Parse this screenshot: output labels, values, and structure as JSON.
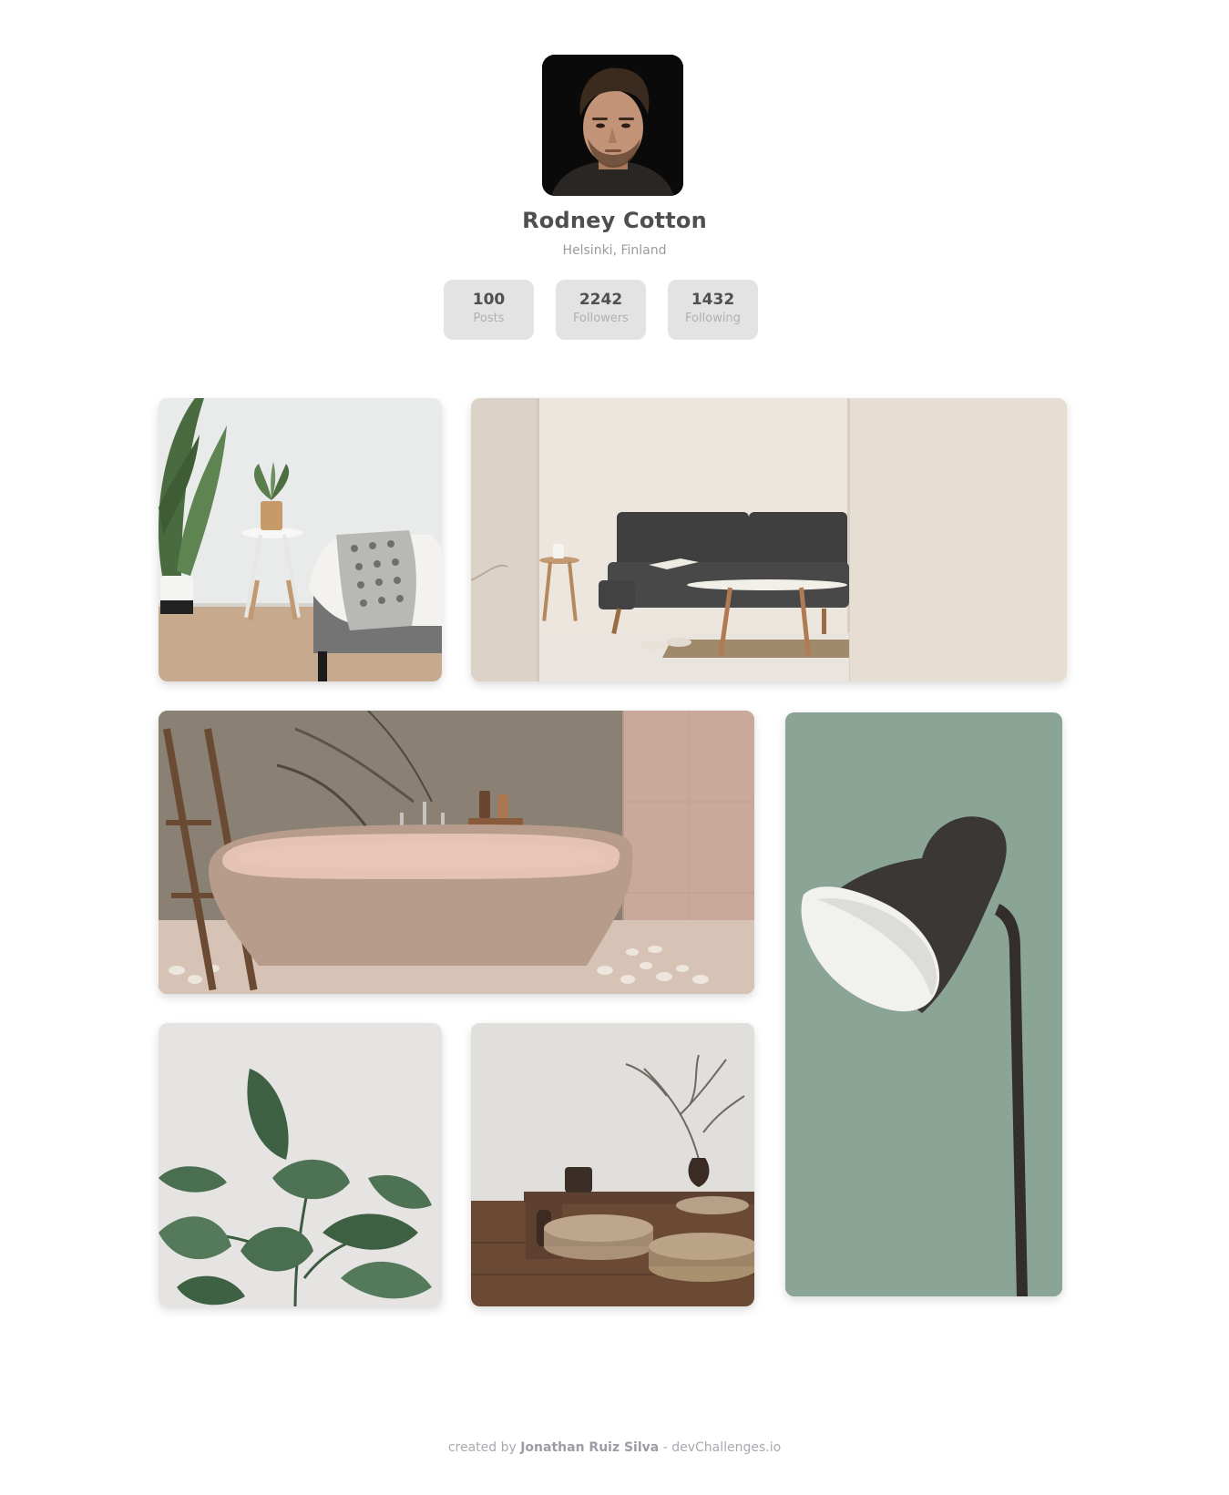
{
  "profile": {
    "name": "Rodney Cotton",
    "location": "Helsinki, Finland",
    "avatar_alt": "avatar"
  },
  "stats": [
    {
      "value": "100",
      "label": "Posts"
    },
    {
      "value": "2242",
      "label": "Followers"
    },
    {
      "value": "1432",
      "label": "Following"
    }
  ],
  "gallery": {
    "items": [
      {
        "subject": "bedroom with plant and side table"
      },
      {
        "subject": "living room with dark sofa"
      },
      {
        "subject": "bathroom with stone bathtub"
      },
      {
        "subject": "dark floor lamp on green wall"
      },
      {
        "subject": "rubber plant leaves"
      },
      {
        "subject": "tea room with low table and cushions"
      }
    ]
  },
  "footer": {
    "prefix": "created by",
    "author": "Jonathan Ruiz Silva",
    "separator": "-",
    "site": "devChallenges.io"
  }
}
